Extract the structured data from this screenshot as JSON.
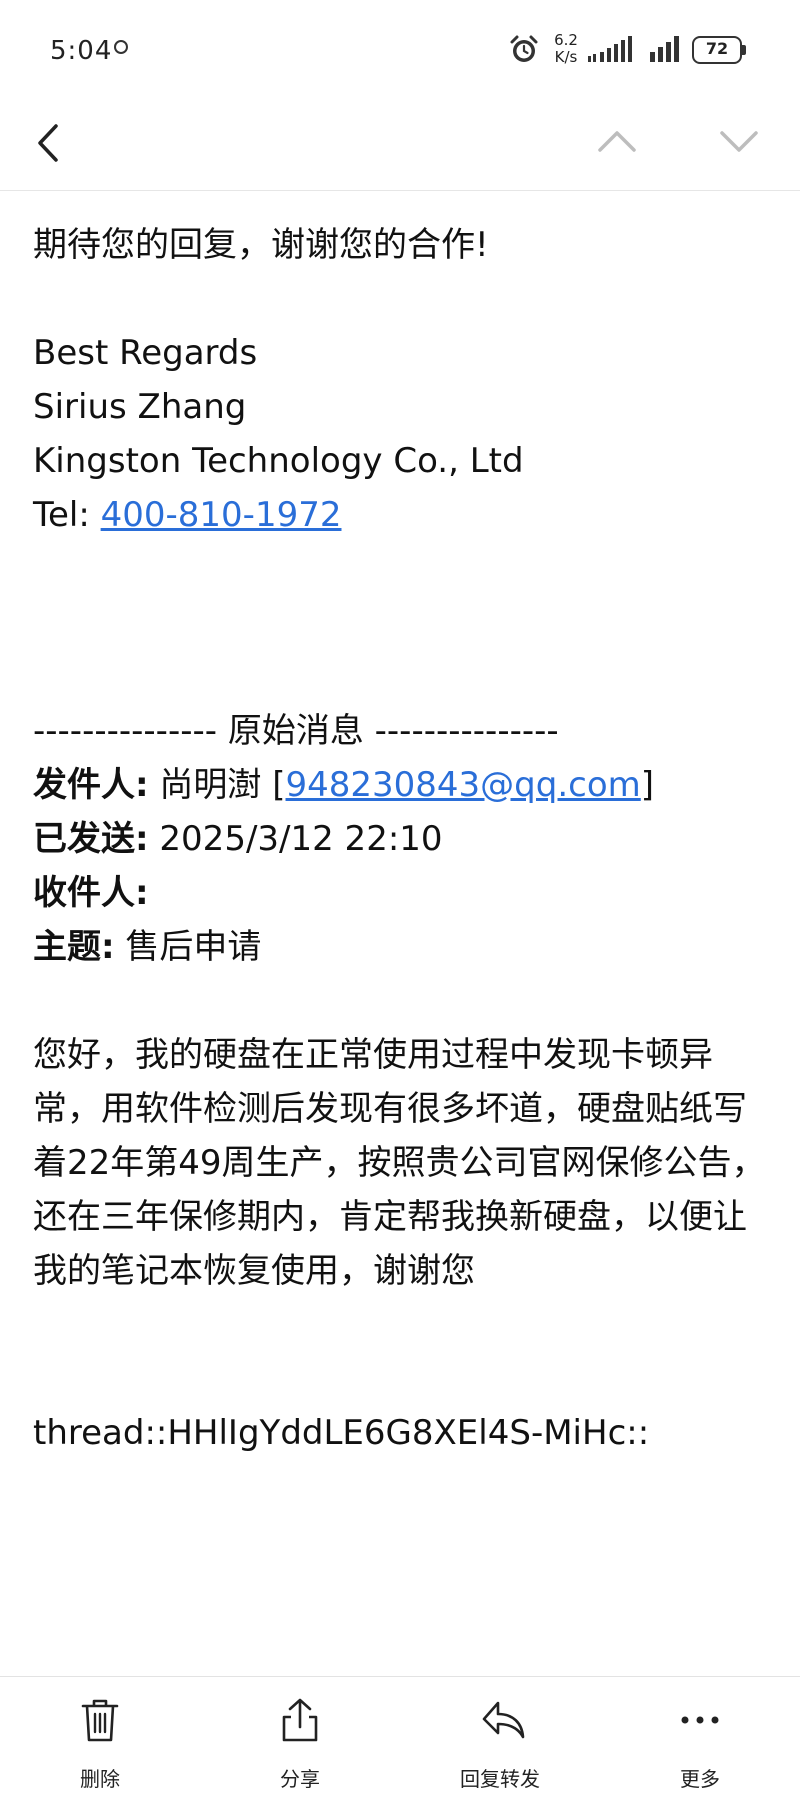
{
  "status_bar": {
    "time": "5:04",
    "speed_value": "6.2",
    "speed_unit": "K/s",
    "battery": "72"
  },
  "nav": {
    "back_icon": "chevron-left-icon",
    "prev_icon": "chevron-up-icon",
    "next_icon": "chevron-down-icon"
  },
  "email": {
    "closing": "期待您的回复，谢谢您的合作!",
    "signature": {
      "regards": "Best Regards",
      "name": "Sirius Zhang",
      "company": "Kingston Technology Co., Ltd",
      "tel_label": "Tel: ",
      "tel": "400-810-1972"
    },
    "original": {
      "divider": "--------------- 原始消息 ---------------",
      "from_label": "发件人:",
      "from_name": " 尚明澍 [",
      "from_email": "948230843@qq.com",
      "from_close": "]",
      "sent_label": "已发送:",
      "sent_value": " 2025/3/12 22:10",
      "to_label": "收件人:",
      "subject_label": "主题:",
      "subject_value": " 售后申请",
      "body": "您好，我的硬盘在正常使用过程中发现卡顿异常，用软件检测后发现有很多坏道，硬盘贴纸写着22年第49周生产，按照贵公司官网保修公告，还在三年保修期内，肯定帮我换新硬盘，以便让我的笔记本恢复使用，谢谢您"
    },
    "thread_id": "thread::HHlIgYddLE6G8XEl4S-MiHc::"
  },
  "toolbar": {
    "delete_label": "删除",
    "share_label": "分享",
    "reply_label": "回复转发",
    "more_label": "更多"
  },
  "colors": {
    "link": "#2a6ed8",
    "text": "#111111",
    "icon": "#333333"
  }
}
